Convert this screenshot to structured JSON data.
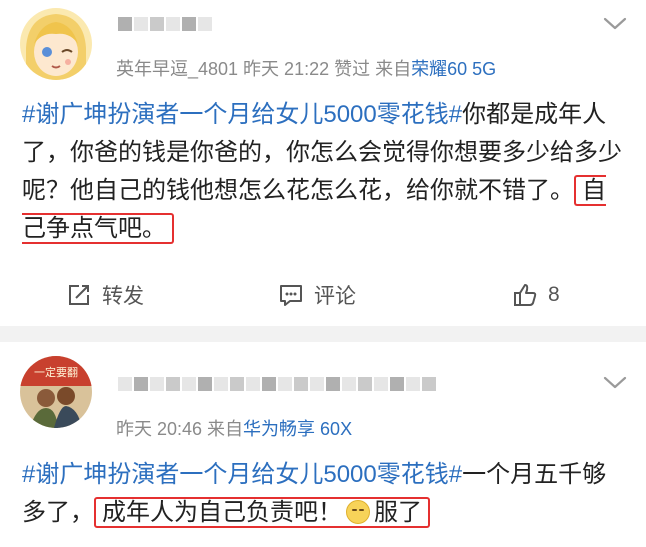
{
  "posts": [
    {
      "meta_prefix": "英年早逗_4801 昨天 21:22 赞过  来自",
      "device": "荣耀60 5G",
      "text_hashtag": "#谢广坤扮演者一个月给女儿5000零花钱#",
      "text_body": "你都是成年人了，你爸的钱是你爸的，你怎么会觉得你想要多少给多少呢？他自己的钱他想怎么花怎么花，给你就不错了。",
      "text_highlight": "自己争点气吧。",
      "actions": {
        "repost": "转发",
        "comment": "评论",
        "like_count": "8"
      }
    },
    {
      "meta_prefix": "昨天 20:46  来自",
      "device": "华为畅享 60X",
      "text_hashtag": "#谢广坤扮演者一个月给女儿5000零花钱#",
      "text_body": "一个月五千够多了，",
      "text_highlight": "成年人为自己负责吧！",
      "text_tail": "服了",
      "avatar_text": "一定要翻"
    }
  ],
  "icons": {
    "repost": "share-edit-icon",
    "comment": "comment-icon",
    "like": "thumbs-up-icon",
    "menu": "chevron-down-icon",
    "emoji": "shush-face-emoji"
  },
  "colors": {
    "link": "#2c6fbf",
    "highlight_border": "#e53030",
    "meta": "#8a8a8a"
  }
}
